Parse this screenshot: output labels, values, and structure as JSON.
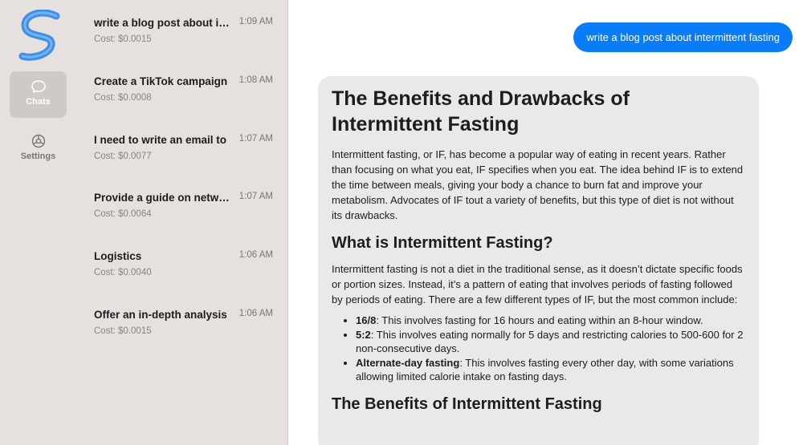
{
  "nav": {
    "chats_label": "Chats",
    "settings_label": "Settings"
  },
  "chats": [
    {
      "title": "write a blog post about intermittent fasting",
      "time": "1:09 AM",
      "cost": "Cost: $0.0015",
      "selected": true
    },
    {
      "title": "Create a TikTok campaign",
      "time": "1:08 AM",
      "cost": "Cost: $0.0008",
      "selected": false
    },
    {
      "title": "I need to write an email to",
      "time": "1:07 AM",
      "cost": "Cost: $0.0077",
      "selected": false
    },
    {
      "title": "Provide a guide on networking",
      "time": "1:07 AM",
      "cost": "Cost: $0.0064",
      "selected": false
    },
    {
      "title": "Logistics",
      "time": "1:06 AM",
      "cost": "Cost: $0.0040",
      "selected": false
    },
    {
      "title": "Offer an in-depth analysis",
      "time": "1:06 AM",
      "cost": "Cost: $0.0015",
      "selected": false
    }
  ],
  "conversation": {
    "user_message": "write a blog post about intermittent fasting",
    "reply": {
      "title": "The Benefits and Drawbacks of Intermittent Fasting",
      "intro": "Intermittent fasting, or IF, has become a popular way of eating in recent years. Rather than focusing on what you eat, IF specifies when you eat. The idea behind IF is to extend the time between meals, giving your body a chance to burn fat and improve your metabolism. Advocates of IF tout a variety of benefits, but this type of diet is not without its drawbacks.",
      "section1_heading": "What is Intermittent Fasting?",
      "section1_text": "Intermittent fasting is not a diet in the traditional sense, as it doesn’t dictate specific foods or portion sizes. Instead, it’s a pattern of eating that involves periods of fasting followed by periods of eating. There are a few different types of IF, but the most common include:",
      "types": [
        {
          "name": "16/8",
          "desc": ": This involves fasting for 16 hours and eating within an 8-hour window."
        },
        {
          "name": "5:2",
          "desc": ": This involves eating normally for 5 days and restricting calories to 500-600 for 2 non-consecutive days."
        },
        {
          "name": "Alternate-day fasting",
          "desc": ": This involves fasting every other day, with some variations allowing limited calorie intake on fasting days."
        }
      ],
      "section2_heading": "The Benefits of Intermittent Fasting"
    }
  },
  "colors": {
    "accent": "#0a7cf6",
    "selected_row": "#4d94f7",
    "sidebar_bg": "#e6e0de",
    "reply_bubble": "#e9e9eb"
  },
  "icons": {
    "logo": "app-logo-s",
    "chats": "speech-bubble-icon",
    "settings": "gear-icon"
  }
}
